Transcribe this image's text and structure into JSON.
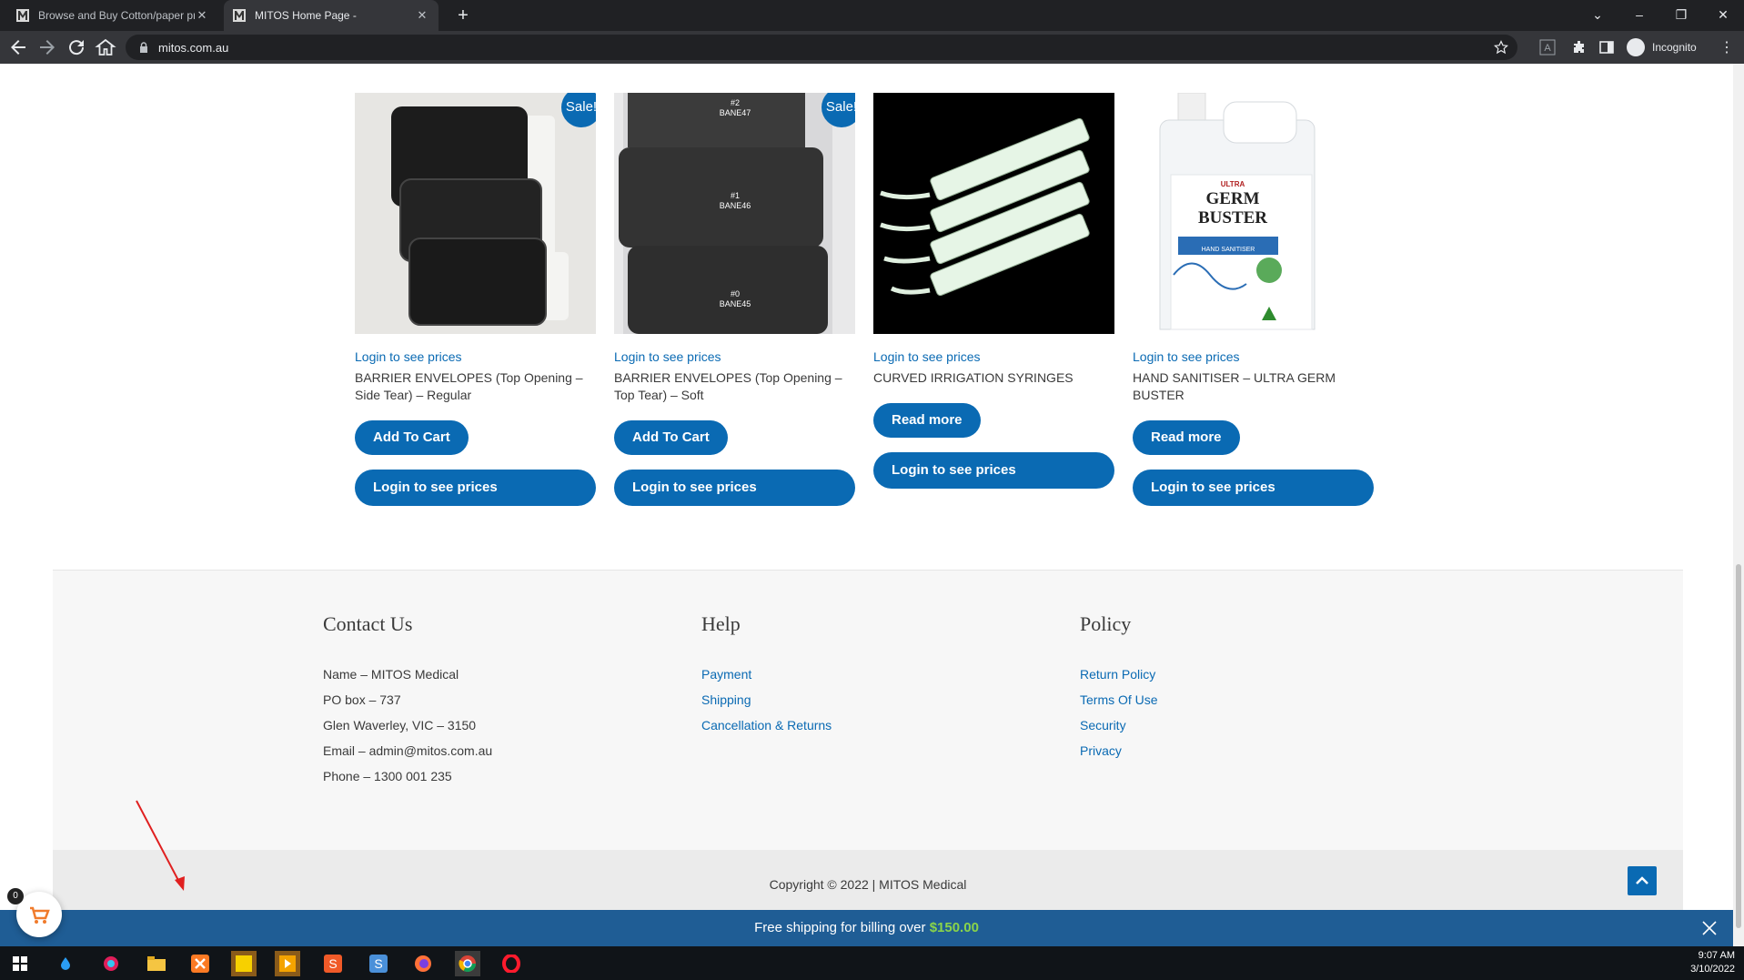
{
  "browser": {
    "tabs": [
      {
        "title": "Browse and Buy Cotton/paper pr",
        "active": false
      },
      {
        "title": "MITOS Home Page -",
        "active": true
      }
    ],
    "url": "mitos.com.au",
    "profile_label": "Incognito"
  },
  "products": [
    {
      "sale_label": "Sale!",
      "price_link": "Login to see prices",
      "title": "BARRIER ENVELOPES (Top Opening – Side Tear) – Regular",
      "primary_button": "Add To Cart",
      "login_button": "Login to see prices"
    },
    {
      "sale_label": "Sale!",
      "price_link": "Login to see prices",
      "title": "BARRIER ENVELOPES (Top Opening – Top Tear) – Soft",
      "primary_button": "Add To Cart",
      "login_button": "Login to see prices",
      "image_labels": [
        "#2",
        "BANE47",
        "#1",
        "BANE46",
        "#0",
        "BANE45"
      ]
    },
    {
      "price_link": "Login to see prices",
      "title": "CURVED IRRIGATION SYRINGES",
      "primary_button": "Read more",
      "login_button": "Login to see prices"
    },
    {
      "price_link": "Login to see prices",
      "title": "HAND SANITISER – ULTRA GERM BUSTER",
      "primary_button": "Read more",
      "login_button": "Login to see prices",
      "image_labels": [
        "ULTRA",
        "GERM",
        "BUSTER",
        "HAND SANITISER"
      ]
    }
  ],
  "footer": {
    "contact": {
      "heading": "Contact Us",
      "lines": [
        "Name – MITOS Medical",
        "PO box – 737",
        "Glen Waverley, VIC – 3150",
        "Email – admin@mitos.com.au",
        "Phone – 1300 001 235"
      ]
    },
    "help": {
      "heading": "Help",
      "links": [
        "Payment",
        "Shipping",
        "Cancellation & Returns"
      ]
    },
    "policy": {
      "heading": "Policy",
      "links": [
        "Return Policy",
        "Terms Of Use",
        "Security",
        "Privacy"
      ]
    },
    "copyright": "Copyright © 2022 | MITOS Medical"
  },
  "shipping_bar": {
    "text": "Free shipping for billing over",
    "amount": "$150.00"
  },
  "cart": {
    "count": "0"
  },
  "taskbar": {
    "time": "9:07 AM",
    "date": "3/10/2022"
  },
  "colors": {
    "brand_blue": "#0a6ab3",
    "shipping_bar": "#1f5d95",
    "amount_green": "#8ad44a"
  }
}
